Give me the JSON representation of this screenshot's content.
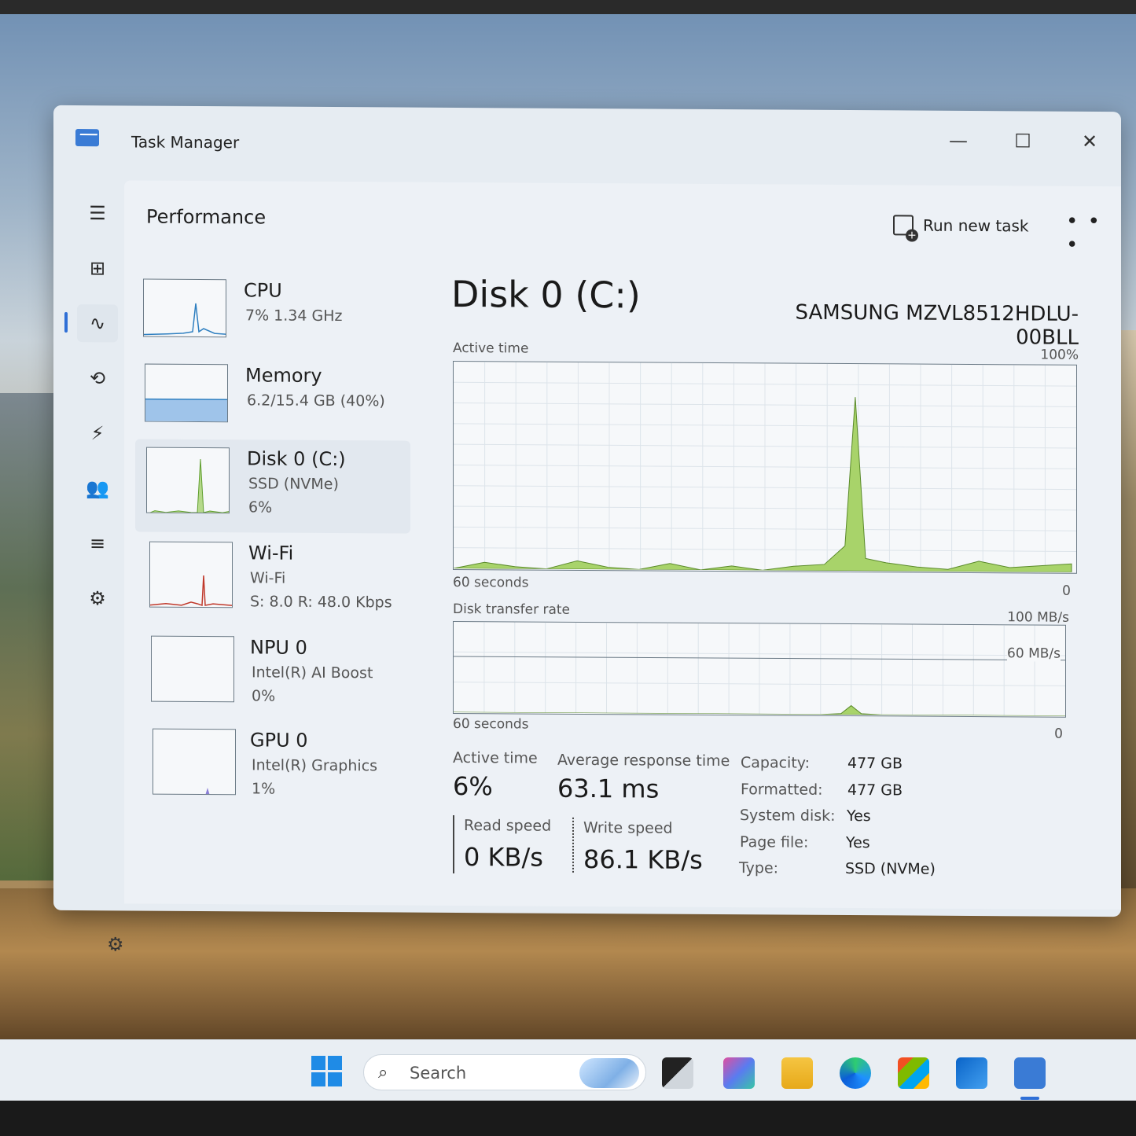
{
  "window": {
    "title": "Task Manager",
    "controls": {
      "minimize": "—",
      "maximize": "☐",
      "close": "✕"
    }
  },
  "nav": {
    "items": [
      {
        "icon": "hamburger-icon",
        "glyph": "☰"
      },
      {
        "icon": "processes-icon",
        "glyph": "⊞"
      },
      {
        "icon": "performance-icon",
        "glyph": "∿",
        "active": true
      },
      {
        "icon": "app-history-icon",
        "glyph": "⟲"
      },
      {
        "icon": "startup-apps-icon",
        "glyph": "⚡"
      },
      {
        "icon": "users-icon",
        "glyph": "👥"
      },
      {
        "icon": "details-icon",
        "glyph": "≡"
      },
      {
        "icon": "services-icon",
        "glyph": "⚙"
      }
    ],
    "settings_glyph": "⚙"
  },
  "header": {
    "title": "Performance",
    "run_new_task": "Run new task",
    "more": "• • •"
  },
  "devices": [
    {
      "name": "CPU",
      "sub1": "7%  1.34 GHz",
      "sub2": "",
      "color": "#2e7fc0"
    },
    {
      "name": "Memory",
      "sub1": "6.2/15.4 GB (40%)",
      "sub2": "",
      "color": "#5a9bd6"
    },
    {
      "name": "Disk 0 (C:)",
      "sub1": "SSD (NVMe)",
      "sub2": "6%",
      "color": "#5f9e2e",
      "selected": true
    },
    {
      "name": "Wi-Fi",
      "sub1": "Wi-Fi",
      "sub2": "S: 8.0  R: 48.0 Kbps",
      "color": "#c0392b"
    },
    {
      "name": "NPU 0",
      "sub1": "Intel(R) AI Boost",
      "sub2": "0%",
      "color": "#5a9bd6"
    },
    {
      "name": "GPU 0",
      "sub1": "Intel(R) Graphics",
      "sub2": "1%",
      "color": "#6a5acd"
    }
  ],
  "main": {
    "title": "Disk 0 (C:)",
    "model": "SAMSUNG MZVL8512HDLU-00BLL",
    "graph1": {
      "label": "Active time",
      "max_label": "100%",
      "time_label": "60 seconds",
      "min_label": "0"
    },
    "graph2": {
      "label": "Disk transfer rate",
      "max_label": "100 MB/s",
      "mid_label": "60 MB/s",
      "time_label": "60 seconds",
      "min_label": "0"
    },
    "stats": {
      "active_time_label": "Active time",
      "active_time_value": "6%",
      "avg_response_label": "Average response time",
      "avg_response_value": "63.1 ms",
      "read_label": "Read speed",
      "read_value": "0 KB/s",
      "write_label": "Write speed",
      "write_value": "86.1 KB/s"
    },
    "info": [
      {
        "label": "Capacity:",
        "value": "477 GB"
      },
      {
        "label": "Formatted:",
        "value": "477 GB"
      },
      {
        "label": "System disk:",
        "value": "Yes"
      },
      {
        "label": "Page file:",
        "value": "Yes"
      },
      {
        "label": "Type:",
        "value": "SSD (NVMe)"
      }
    ]
  },
  "chart_data": [
    {
      "type": "area",
      "title": "Active time",
      "ylim": [
        0,
        100
      ],
      "x": [
        0,
        3,
        6,
        9,
        12,
        15,
        18,
        21,
        24,
        27,
        30,
        33,
        36,
        38,
        39,
        40,
        42,
        45,
        48,
        51,
        54,
        57,
        60
      ],
      "values": [
        0,
        3,
        1,
        0,
        4,
        1,
        0,
        3,
        0,
        2,
        0,
        2,
        3,
        12,
        84,
        6,
        4,
        2,
        1,
        5,
        2,
        3,
        4
      ],
      "color": "#a8d36a"
    },
    {
      "type": "area",
      "title": "Disk transfer rate",
      "ylim": [
        0,
        100
      ],
      "x": [
        0,
        10,
        20,
        30,
        36,
        38,
        39,
        40,
        42,
        50,
        60
      ],
      "values": [
        0,
        0,
        0,
        0,
        0,
        1,
        10,
        1,
        0,
        0,
        0
      ],
      "color": "#a8d36a"
    }
  ],
  "taskbar": {
    "search_placeholder": "Search",
    "search_glyph": "⌕"
  }
}
